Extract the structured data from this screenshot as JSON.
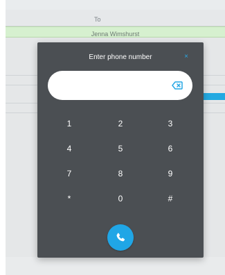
{
  "background": {
    "to_label": "To",
    "contact_name": "Jenna Wimshurst"
  },
  "dialog": {
    "title": "Enter phone number",
    "close_icon": "close-icon",
    "input_value": "",
    "input_placeholder": "",
    "backspace_icon": "backspace-icon",
    "keys": [
      "1",
      "2",
      "3",
      "4",
      "5",
      "6",
      "7",
      "8",
      "9",
      "*",
      "0",
      "#"
    ],
    "call_icon": "phone-icon"
  },
  "colors": {
    "accent": "#20a6e6",
    "dialog_bg": "#4b4f53",
    "contact_row_bg": "#d6f0cf"
  }
}
